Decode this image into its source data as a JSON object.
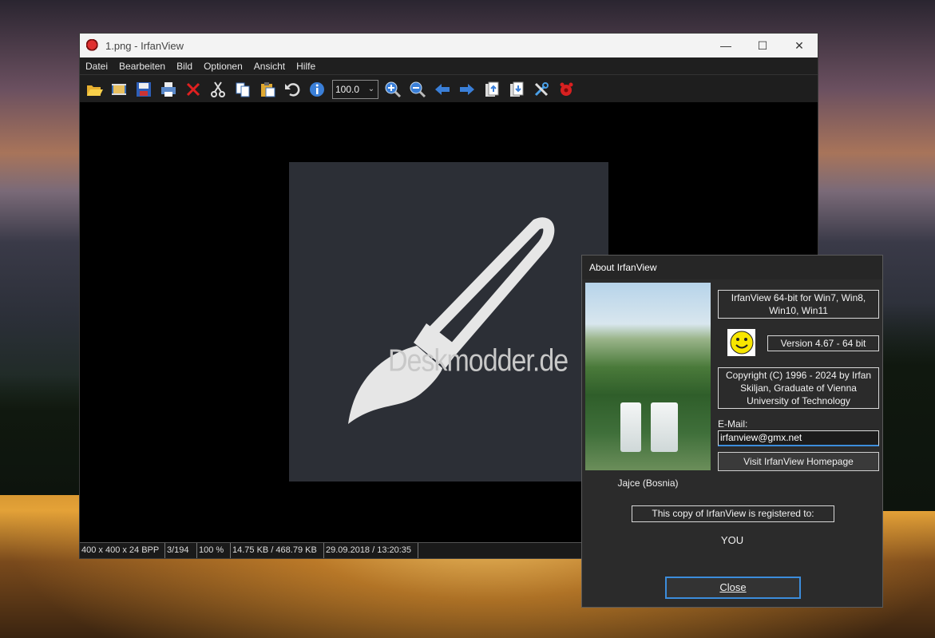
{
  "window": {
    "title": "1.png - IrfanView",
    "minimize": "—",
    "maximize": "☐",
    "close": "✕"
  },
  "menu": [
    "Datei",
    "Bearbeiten",
    "Bild",
    "Optionen",
    "Ansicht",
    "Hilfe"
  ],
  "toolbar": {
    "zoom_value": "100.0",
    "icons": [
      "open-icon",
      "thumbnails-icon",
      "save-icon",
      "print-icon",
      "delete-icon",
      "cut-icon",
      "copy-icon",
      "paste-icon",
      "undo-icon",
      "info-icon",
      "zoom-in-icon",
      "zoom-out-icon",
      "previous-icon",
      "next-icon",
      "first-page-icon",
      "last-page-icon",
      "settings-icon",
      "irfanview-icon"
    ]
  },
  "image": {
    "watermark": "Deskmodder.de"
  },
  "statusbar": {
    "dimensions": "400 x 400 x 24 BPP",
    "position": "3/194",
    "zoom": "100 %",
    "size": "14.75 KB / 468.79 KB",
    "datetime": "29.09.2018 / 13:20:35"
  },
  "about": {
    "title": "About  IrfanView",
    "photo_caption": "Jajce (Bosnia)",
    "edition": "IrfanView 64-bit for Win7, Win8, Win10, Win11",
    "version": "Version 4.67 - 64 bit",
    "copyright": "Copyright (C) 1996 - 2024 by Irfan Skiljan, Graduate of Vienna University of Technology",
    "email_label": "E-Mail:",
    "email": "irfanview@gmx.net",
    "homepage_button": "Visit IrfanView Homepage",
    "registered_label": "This copy of IrfanView is registered to:",
    "registered_name": "YOU",
    "close_button": "Close"
  },
  "colors": {
    "accent": "#3c8ddc",
    "dialog_bg": "#2b2b2b",
    "image_bg": "#2c2f36"
  }
}
